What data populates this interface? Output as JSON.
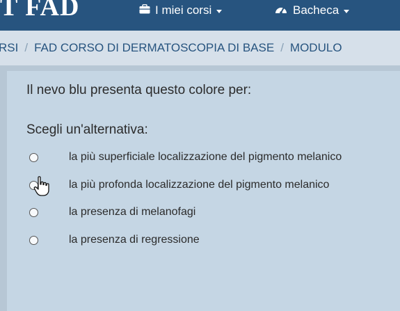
{
  "header": {
    "brand": "T FAD",
    "nav": [
      {
        "label": "I miei corsi",
        "icon": "briefcase-icon"
      },
      {
        "label": "Bacheca",
        "icon": "dashboard-icon"
      }
    ]
  },
  "breadcrumb": [
    "RSI",
    "FAD CORSO DI DERMATOSCOPIA DI BASE",
    "MODULO"
  ],
  "quiz": {
    "question": "Il nevo blu presenta questo colore per:",
    "prompt": "Scegli un'alternativa:",
    "options": [
      "la più superficiale localizzazione del pigmento melanico",
      "la più profonda localizzazione del pigmento melanico",
      "la presenza di melanofagi",
      "la presenza di regressione"
    ]
  },
  "colors": {
    "header_bg": "#27547f",
    "breadcrumb_bg": "#d6e0ea",
    "content_bg": "#c5d6e4"
  }
}
